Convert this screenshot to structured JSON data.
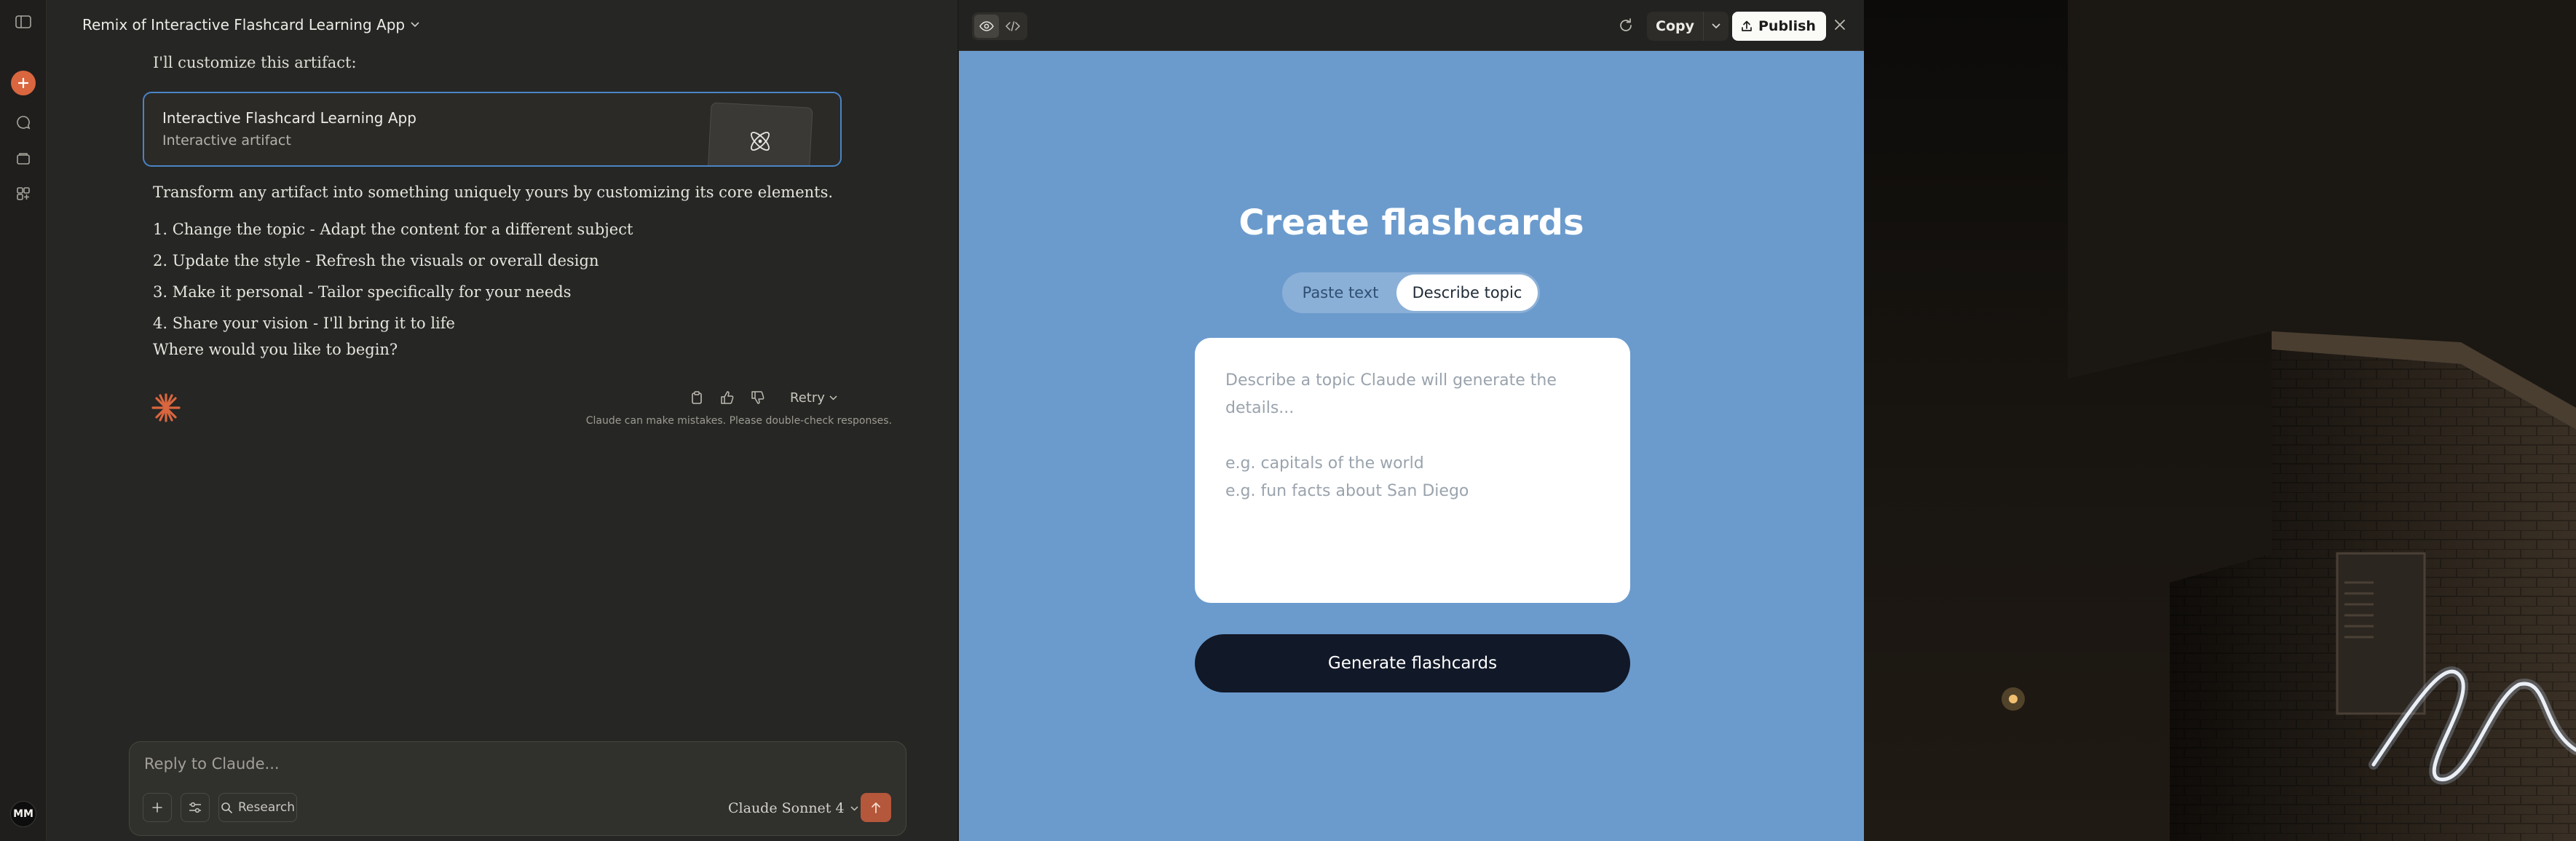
{
  "sidebar": {
    "new_chat_label": "New chat",
    "avatar_initials": "MM"
  },
  "chat": {
    "title": "Remix of Interactive Flashcard Learning App",
    "intro": "I'll customize this artifact:",
    "artifact": {
      "title": "Interactive Flashcard Learning App",
      "subtitle": "Interactive artifact"
    },
    "paragraph": "Transform any artifact into something uniquely yours by customizing its core elements.",
    "steps": [
      "1. Change the topic - Adapt the content for a different subject",
      "2. Update the style - Refresh the visuals or overall design",
      "3. Make it personal - Tailor specifically for your needs",
      "4. Share your vision - I'll bring it to life"
    ],
    "closing": "Where would you like to begin?",
    "retry_label": "Retry",
    "disclaimer": "Claude can make mistakes. Please double-check responses."
  },
  "composer": {
    "placeholder": "Reply to Claude...",
    "research_label": "Research",
    "model_label": "Claude Sonnet 4"
  },
  "artifact_panel": {
    "copy_label": "Copy",
    "publish_label": "Publish",
    "app": {
      "title": "Create flashcards",
      "tabs": [
        "Paste text",
        "Describe topic"
      ],
      "active_tab": "Describe topic",
      "topic_placeholder": "Describe a topic Claude will generate the details...\n\ne.g. capitals of the world\ne.g. fun facts about San Diego",
      "generate_label": "Generate flashcards"
    }
  },
  "colors": {
    "accent_orange": "#d9663f",
    "panel_blue": "#6b9bcd",
    "generate_button": "#111827",
    "card_border_blue": "#4b84c5"
  }
}
